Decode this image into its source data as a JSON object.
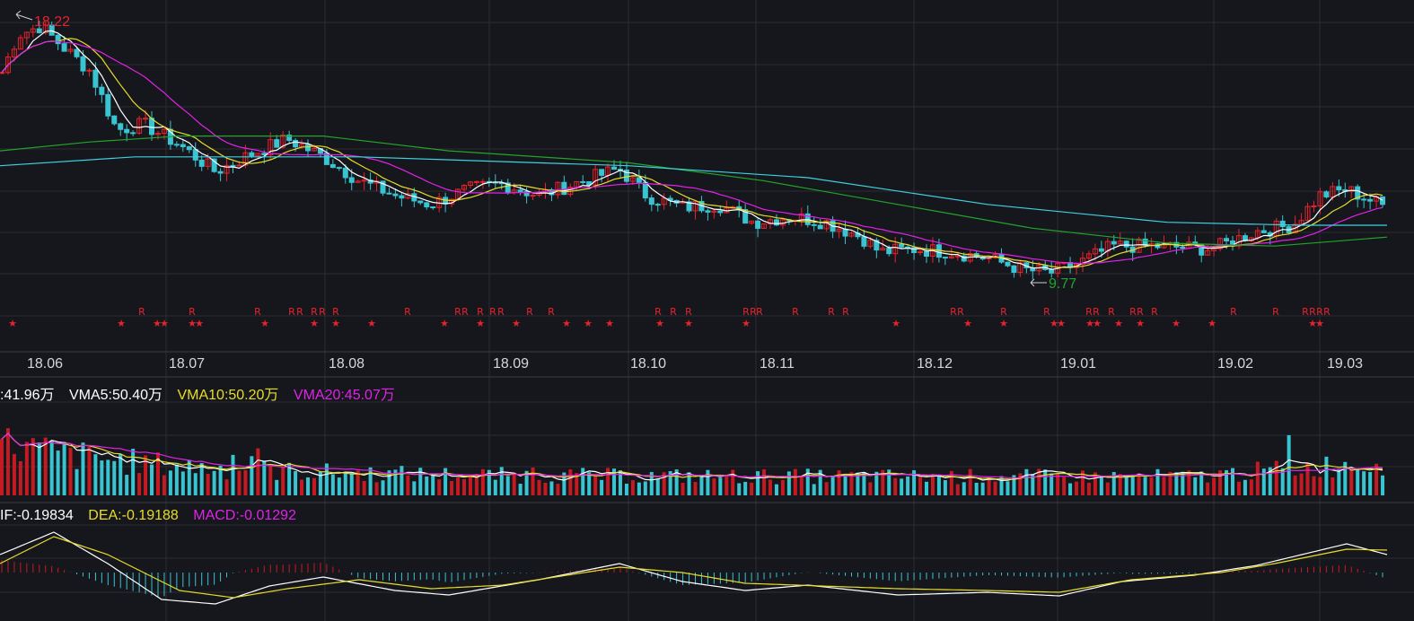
{
  "colors": {
    "background": "#16171c",
    "grid": "#2b2d33",
    "up": "#e8222d",
    "down": "#39c4d2",
    "ma5": "#ffffff",
    "ma10": "#e8dc28",
    "ma20": "#e022e8",
    "ma60": "#22a52a",
    "ma120": "#3fd1de"
  },
  "price_panel": {
    "high_marker": "18.22",
    "low_marker": "9.77",
    "signal_R": "R",
    "signal_star": "★",
    "date_labels": [
      "18.06",
      "18.07",
      "18.08",
      "18.09",
      "18.10",
      "18.11",
      "18.12",
      "19.01",
      "19.02",
      "19.03"
    ]
  },
  "volume_panel": {
    "vol_label": ":41.96万",
    "vma5_label": "VMA5:50.40万",
    "vma10_label": "VMA10:50.20万",
    "vma20_label": "VMA20:45.07万"
  },
  "macd_panel": {
    "dif_label": "IF:-0.19834",
    "dea_label": "DEA:-0.19188",
    "macd_label": "MACD:-0.01292"
  },
  "chart_data": [
    {
      "type": "candlestick",
      "title": "",
      "xlabel": "",
      "ylabel": "",
      "x": [
        "18.06",
        "18.07",
        "18.08",
        "18.09",
        "18.10",
        "18.11",
        "18.12",
        "19.01",
        "19.02",
        "19.03"
      ],
      "close_approx": [
        17.2,
        14.0,
        13.6,
        12.6,
        13.1,
        11.6,
        10.7,
        10.1,
        10.9,
        12.7
      ],
      "annotations": [
        {
          "label": "18.22",
          "type": "high"
        },
        {
          "label": "9.77",
          "type": "low"
        }
      ],
      "series": [
        {
          "name": "MA5",
          "values": [
            17.0,
            14.1,
            13.5,
            12.6,
            13.0,
            11.7,
            10.7,
            10.1,
            10.9,
            12.6
          ]
        },
        {
          "name": "MA10",
          "values": [
            17.3,
            14.3,
            13.6,
            12.7,
            12.9,
            11.8,
            10.8,
            10.1,
            10.8,
            12.4
          ]
        },
        {
          "name": "MA20",
          "values": [
            16.8,
            15.2,
            13.8,
            12.9,
            12.8,
            12.0,
            11.0,
            10.3,
            10.5,
            12.0
          ]
        },
        {
          "name": "MA60",
          "values": [
            13.8,
            14.0,
            13.9,
            13.4,
            12.9,
            12.4,
            11.6,
            10.9,
            10.7,
            11.0
          ]
        },
        {
          "name": "MA120",
          "values": [
            13.3,
            13.6,
            13.6,
            13.4,
            13.2,
            12.9,
            12.2,
            11.6,
            11.2,
            11.1
          ]
        }
      ]
    },
    {
      "type": "bar",
      "title": "",
      "xlabel": "",
      "ylabel": "",
      "x": [
        "18.06",
        "18.07",
        "18.08",
        "18.09",
        "18.10",
        "18.11",
        "18.12",
        "19.01",
        "19.02",
        "19.03"
      ],
      "series": [
        {
          "name": "VMA5",
          "values": [
            95,
            55,
            45,
            40,
            42,
            38,
            32,
            30,
            40,
            70
          ]
        },
        {
          "name": "VMA10",
          "values": [
            90,
            58,
            46,
            40,
            40,
            40,
            33,
            30,
            38,
            65
          ]
        },
        {
          "name": "VMA20",
          "values": [
            75,
            60,
            50,
            42,
            40,
            40,
            35,
            32,
            36,
            55
          ]
        }
      ]
    },
    {
      "type": "line",
      "title": "",
      "xlabel": "",
      "ylabel": "",
      "x": [
        "18.06",
        "18.07",
        "18.08",
        "18.09",
        "18.10",
        "18.11",
        "18.12",
        "19.01",
        "19.02",
        "19.03"
      ],
      "series": [
        {
          "name": "DIF",
          "values": [
            0.3,
            -0.5,
            -0.15,
            -0.35,
            0.05,
            -0.4,
            -0.5,
            -0.45,
            0.0,
            0.45
          ]
        },
        {
          "name": "DEA",
          "values": [
            0.35,
            -0.25,
            -0.15,
            -0.3,
            -0.05,
            -0.3,
            -0.45,
            -0.4,
            -0.05,
            0.3
          ]
        },
        {
          "name": "MACD",
          "values": [
            0.1,
            -0.35,
            0.1,
            0.05,
            0.2,
            -0.2,
            -0.05,
            0.0,
            0.1,
            0.25
          ]
        }
      ]
    }
  ]
}
